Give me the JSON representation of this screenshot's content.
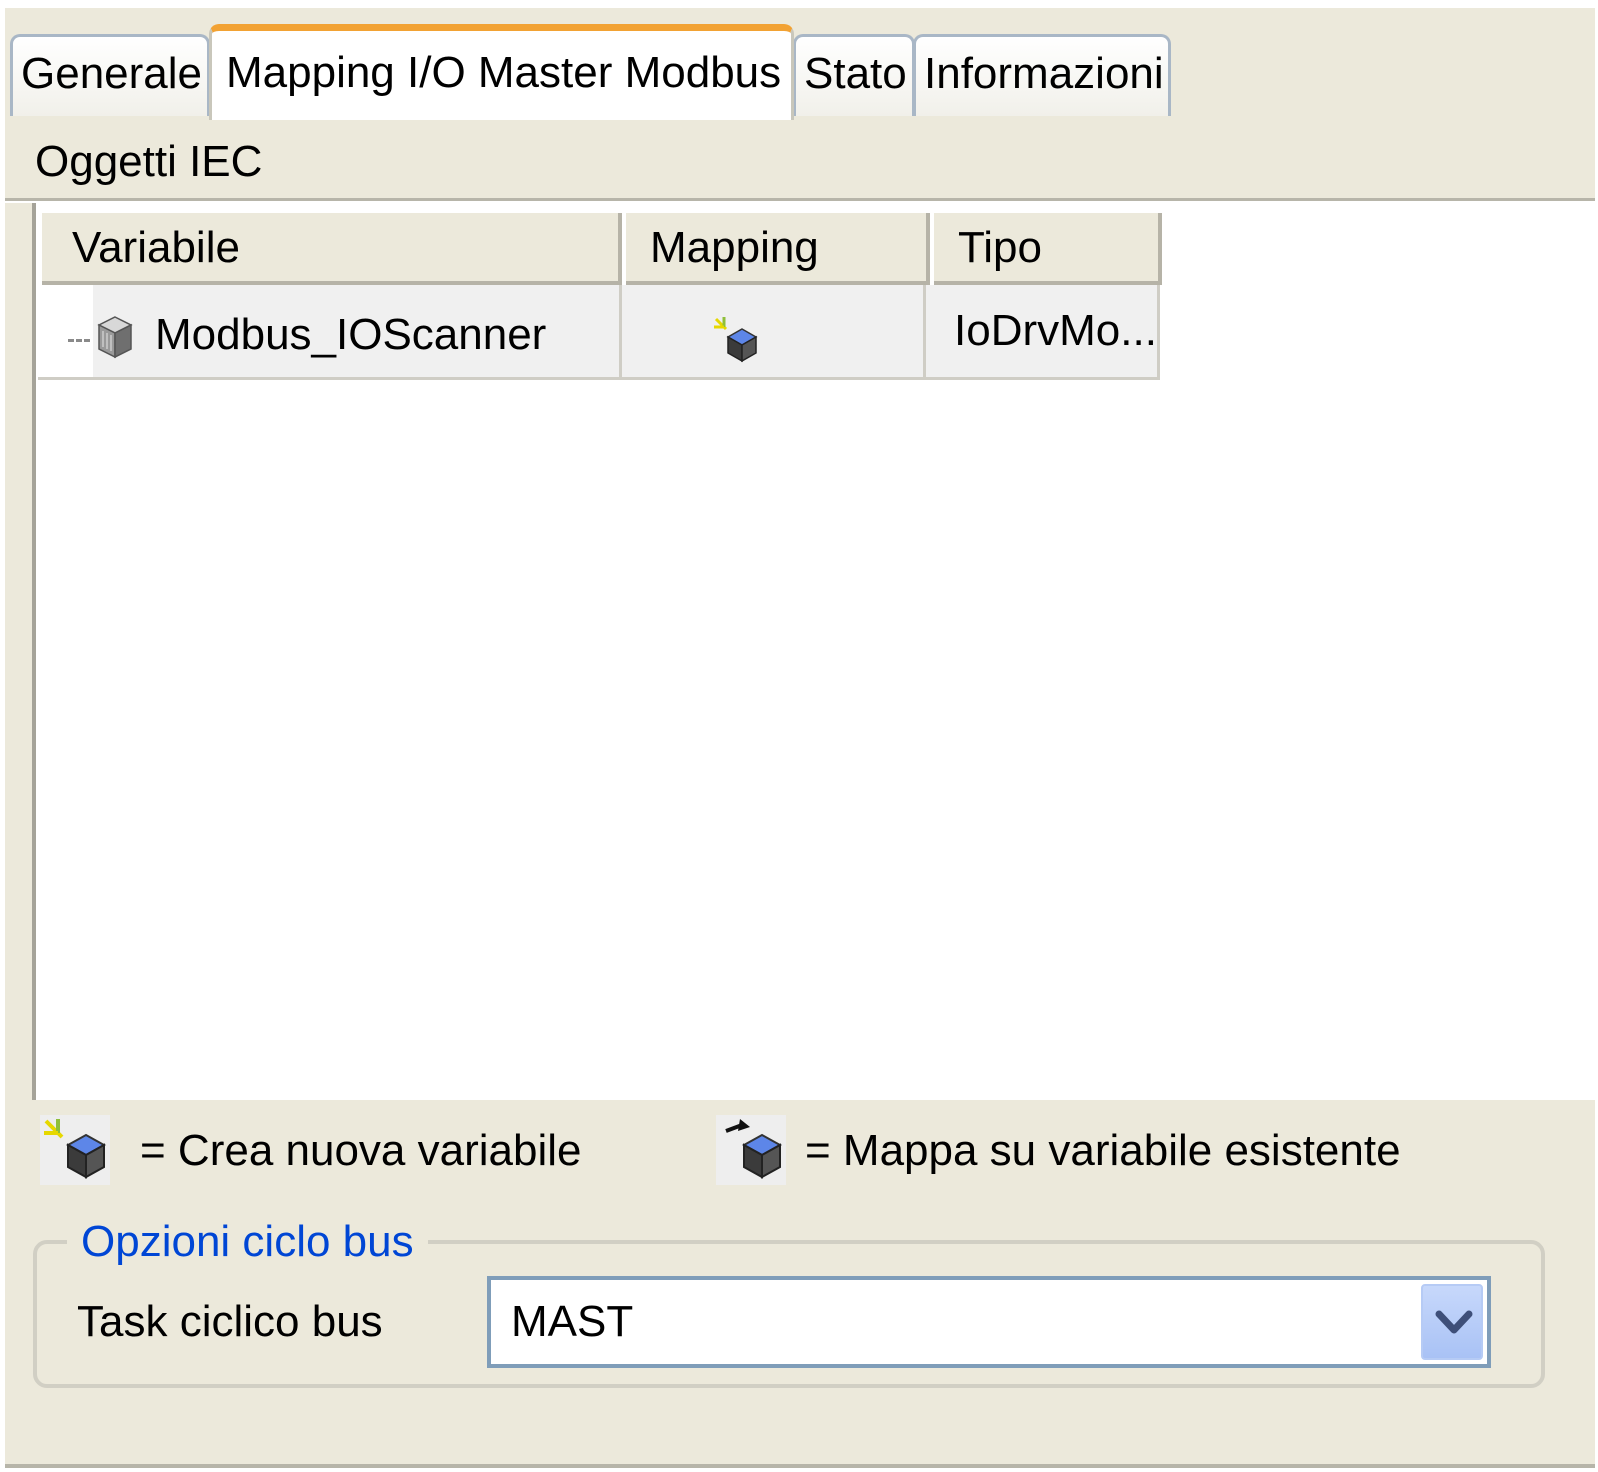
{
  "tabs": [
    {
      "label": "Generale"
    },
    {
      "label": "Mapping I/O Master Modbus",
      "active": true
    },
    {
      "label": "Stato"
    },
    {
      "label": "Informazioni"
    }
  ],
  "section": {
    "title": "Oggetti IEC"
  },
  "table": {
    "columns": [
      "Variabile",
      "Mapping",
      "Tipo"
    ],
    "rows": [
      {
        "variable": "Modbus_IOScanner",
        "mapping_icon": "new-variable-icon",
        "type": "IoDrvMo..."
      }
    ]
  },
  "legend": {
    "new_variable": "= Crea nuova variabile",
    "existing_variable": "= Mappa su variabile esistente"
  },
  "bus_cycle": {
    "group_title": "Opzioni ciclo bus",
    "label": "Task ciclico bus",
    "selected": "MAST"
  },
  "colors": {
    "panel_bg": "#ece9db",
    "active_tab_accent": "#f2a233",
    "group_title": "#0046d5",
    "select_border": "#7f9db9"
  }
}
